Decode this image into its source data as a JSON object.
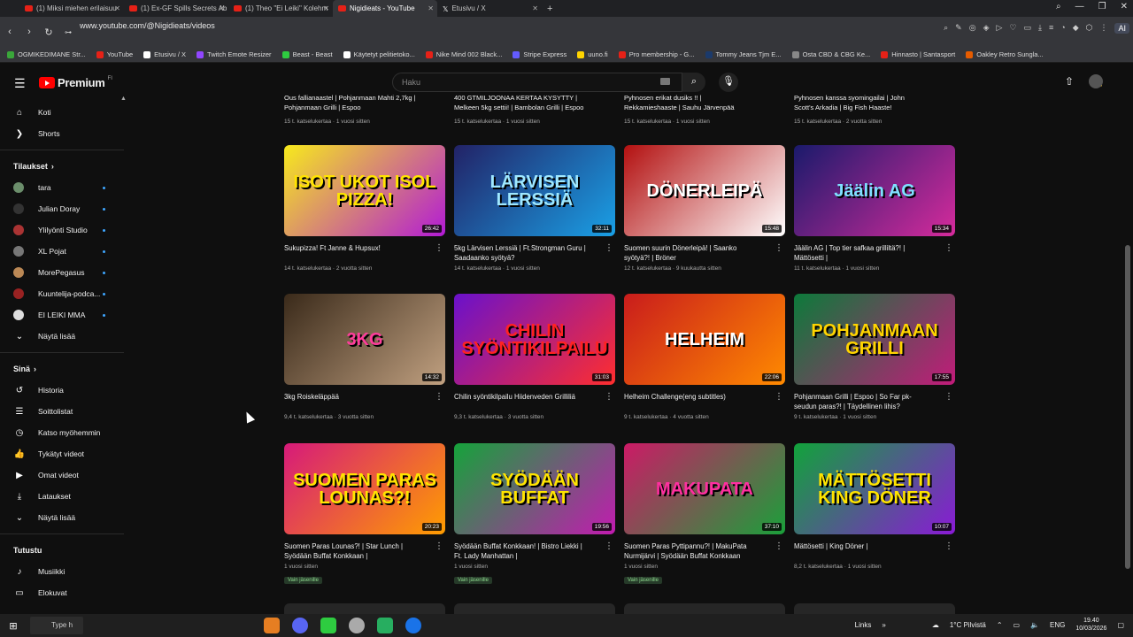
{
  "browser": {
    "tabs": [
      {
        "label": "(1) Miksi miehen erilaisuu",
        "icon": "youtube-icon"
      },
      {
        "label": "(1) Ex-GF Spills Secrets Ab",
        "icon": "youtube-icon"
      },
      {
        "label": "(1) Theo \"Ei Leiki\" Kolehm",
        "icon": "youtube-icon"
      },
      {
        "label": "Nigidieats - YouTube",
        "icon": "youtube-icon",
        "active": true
      },
      {
        "label": "Etusivu / X",
        "icon": "x-icon"
      }
    ],
    "new_tab": "+",
    "url": "www.youtube.com/@Nigidieats/videos",
    "ai_label": "AI",
    "bookmarks": [
      {
        "label": "OGMIKEDIMANE Str...",
        "color": "#3aa63a"
      },
      {
        "label": "YouTube",
        "color": "#e62117"
      },
      {
        "label": "Etusivu / X",
        "color": "#ffffff"
      },
      {
        "label": "Twitch Emote Resizer",
        "color": "#9146ff"
      },
      {
        "label": "Beast - Beast",
        "color": "#2ecc40"
      },
      {
        "label": "Käytetyt pelitietoko...",
        "color": "#ffffff"
      },
      {
        "label": "Nike Mind 002 Black...",
        "color": "#e62117"
      },
      {
        "label": "Stripe Express",
        "color": "#635bff"
      },
      {
        "label": "uuno.fi",
        "color": "#ffd400"
      },
      {
        "label": "Pro membership - G...",
        "color": "#e62117"
      },
      {
        "label": "Tommy Jeans Tjm E...",
        "color": "#1b3a6b"
      },
      {
        "label": "Osta CBD & CBG Ke...",
        "color": "#888888"
      },
      {
        "label": "Hinnasto | Santasport",
        "color": "#e62117"
      },
      {
        "label": "Oakley Retro Sungla...",
        "color": "#e65c00"
      }
    ]
  },
  "youtube": {
    "logo_text": "Premium",
    "logo_sup": "FI",
    "search_placeholder": "Haku"
  },
  "sidebar": {
    "top": [
      {
        "label": "Koti",
        "icon": "home-icon",
        "glyph": "⌂"
      },
      {
        "label": "Shorts",
        "icon": "shorts-icon",
        "glyph": "❯"
      }
    ],
    "subs_header": "Tilaukset",
    "subs": [
      {
        "label": "tara",
        "color": "#6b8e6b"
      },
      {
        "label": "Julian Doray",
        "color": "#333333"
      },
      {
        "label": "Ylilyönti Studio",
        "color": "#a33"
      },
      {
        "label": "XL Pojat",
        "color": "#777777"
      },
      {
        "label": "MorePegasus",
        "color": "#b85"
      },
      {
        "label": "Kuuntelija-podca...",
        "color": "#922"
      },
      {
        "label": "EI LEIKI MMA",
        "color": "#ddd"
      }
    ],
    "show_more": "Näytä lisää",
    "you_header": "Sinä",
    "you": [
      {
        "label": "Historia",
        "icon": "history-icon",
        "glyph": "↺"
      },
      {
        "label": "Soittolistat",
        "icon": "playlists-icon",
        "glyph": "☰"
      },
      {
        "label": "Katso myöhemmin",
        "icon": "watch-later-icon",
        "glyph": "◷"
      },
      {
        "label": "Tykätyt videot",
        "icon": "like-icon",
        "glyph": "👍"
      },
      {
        "label": "Omat videot",
        "icon": "my-videos-icon",
        "glyph": "▶"
      },
      {
        "label": "Lataukset",
        "icon": "downloads-icon",
        "glyph": "⤓"
      },
      {
        "label": "Näytä lisää",
        "icon": "chevron-down-icon",
        "glyph": "⌄"
      }
    ],
    "explore_header": "Tutustu",
    "explore": [
      {
        "label": "Musiikki",
        "icon": "music-icon",
        "glyph": "♪"
      },
      {
        "label": "Elokuvat",
        "icon": "movies-icon",
        "glyph": "▭"
      }
    ]
  },
  "top_row": [
    {
      "title": "Ous fallianaastel | Pohjanmaan Mahti 2,7kg |\nPohjanmaan Grilli | Espoo",
      "meta": "15 t. katselukertaa · 1 vuosi sitten"
    },
    {
      "title": "400 GTMILJOONAA KERTAA KYSYTTY |\nMelkeen 5kg settii! | Bambolan Grilli | Espoo",
      "meta": "15 t. katselukertaa · 1 vuosi sitten"
    },
    {
      "title": "Pyhnosen erikat dusiks !! |\nRekkamieshaaste | Sauhu Järvenpää",
      "meta": "15 t. katselukertaa · 1 vuosi sitten"
    },
    {
      "title": "Pyhnosen kanssa syomingailai | John\nScott's Arkadia | Big Fish Haaste!",
      "meta": "15 t. katselukertaa · 2 vuotta sitten"
    }
  ],
  "videos": [
    {
      "title": "Sukupizza! Ft Janne & Hupsux!",
      "meta": "14 t. katselukertaa · 2 vuotta sitten",
      "duration": "26:42",
      "thumb_text": "ISOT UKOT ISOL PIZZA!",
      "thumb_colors": [
        "#f7ea1c",
        "#b21ad6"
      ],
      "text_color": "#ffe400"
    },
    {
      "title": "5kg Lärvisen Lerssiä | Ft.Strongman Guru |\nSaadaanko syötyä?",
      "meta": "14 t. katselukertaa · 1 vuosi sitten",
      "duration": "32:11",
      "thumb_text": "LÄRVISEN LERSSIÄ",
      "thumb_colors": [
        "#222266",
        "#1aa0e6"
      ],
      "text_color": "#9fe8ff"
    },
    {
      "title": "Suomen suurin Dönerleipä! | Saanko\nsyötyä?! | Bröner",
      "meta": "12 t. katselukertaa · 9 kuukautta sitten",
      "duration": "15:48",
      "thumb_text": "DÖNERLEIPÄ",
      "thumb_colors": [
        "#b31010",
        "#ffffff"
      ],
      "text_color": "#ffffff"
    },
    {
      "title": "Jäälin AG | Top tier safkaa grilliltä?! |\nMättösetti |",
      "meta": "11 t. katselukertaa · 1 vuosi sitten",
      "duration": "15:34",
      "thumb_text": "Jäälin AG",
      "thumb_colors": [
        "#1a1a6b",
        "#d62b9c"
      ],
      "text_color": "#7fe0ff"
    },
    {
      "title": "3kg Roiskeläppää",
      "meta": "9,4 t. katselukertaa · 3 vuotta sitten",
      "duration": "14:32",
      "thumb_text": "3KG",
      "thumb_colors": [
        "#3a2a1a",
        "#c0a080"
      ],
      "text_color": "#ff3c9c"
    },
    {
      "title": "Chilin syöntikilpailu Hiidenveden Grilliliä",
      "meta": "9,3 t. katselukertaa · 3 vuotta sitten",
      "duration": "31:03",
      "thumb_text": "CHILIN SYÖNTIKILPAILU",
      "thumb_colors": [
        "#6a11cb",
        "#ff2e2e"
      ],
      "text_color": "#ff2222"
    },
    {
      "title": "Helheim Challenge(eng subtitles)",
      "meta": "9 t. katselukertaa · 4 vuotta sitten",
      "duration": "22:06",
      "thumb_text": "HELHEIM",
      "thumb_colors": [
        "#c91c1c",
        "#ff8a00"
      ],
      "text_color": "#ffffff"
    },
    {
      "title": "Pohjanmaan Grilli | Espoo | So Far pk-\nseudun paras?! | Täydellinen lihis?",
      "meta": "9 t. katselukertaa · 1 vuosi sitten",
      "duration": "17:55",
      "thumb_text": "POHJANMAAN GRILLI",
      "thumb_colors": [
        "#0c7a3a",
        "#c21b7a"
      ],
      "text_color": "#ffd400"
    },
    {
      "title": "Suomen Paras Lounas?! | Star Lunch |\nSyödään Buffat Konkkaan |",
      "meta": "1 vuosi sitten",
      "duration": "20:23",
      "thumb_text": "SUOMEN PARAS LOUNAS?!",
      "thumb_colors": [
        "#d61a7a",
        "#ff9d00"
      ],
      "text_color": "#ffe400",
      "members": "Vain jäsenille"
    },
    {
      "title": "Syödään Buffat Konkkaan! | Bistro Liekki |\nFt. Lady Manhattan |",
      "meta": "1 vuosi sitten",
      "duration": "19:56",
      "thumb_text": "SYÖDÄÄN BUFFAT",
      "thumb_colors": [
        "#15a33a",
        "#c21bb0"
      ],
      "text_color": "#ffe400",
      "members": "Vain jäsenille"
    },
    {
      "title": "Suomen Paras Pyttipannu?! | MakuPata\nNurmijärvi | Syödään Buffat Konkkaan",
      "meta": "1 vuosi sitten",
      "duration": "37:10",
      "thumb_text": "MAKUPATA",
      "thumb_colors": [
        "#cc1a66",
        "#1aa03a"
      ],
      "text_color": "#ff2ea0",
      "members": "Vain jäsenille"
    },
    {
      "title": "Mättösetti | King Döner |",
      "meta": "8,2 t. katselukertaa · 1 vuosi sitten",
      "duration": "10:07",
      "thumb_text": "MÄTTÖSETTI KING DÖNER",
      "thumb_colors": [
        "#11a33a",
        "#8a1ad6"
      ],
      "text_color": "#ffe400"
    }
  ],
  "taskbar": {
    "search_placeholder": "Type h",
    "links": "Links",
    "weather": "1°C  Pilvistä",
    "lang": "ENG",
    "time": "19.40",
    "date": "10/03/2026"
  }
}
